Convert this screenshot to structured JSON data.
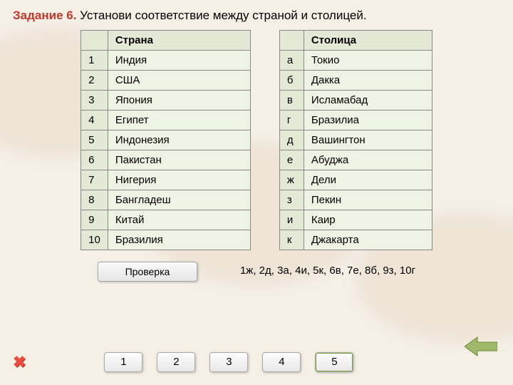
{
  "title": {
    "prefix": "Задание 6.",
    "rest": " Установи соответствие между страной и столицей."
  },
  "left": {
    "header": "Страна",
    "rows": [
      {
        "n": "1",
        "v": "Индия"
      },
      {
        "n": "2",
        "v": "США"
      },
      {
        "n": "3",
        "v": "Япония"
      },
      {
        "n": "4",
        "v": "Египет"
      },
      {
        "n": "5",
        "v": "Индонезия"
      },
      {
        "n": "6",
        "v": "Пакистан"
      },
      {
        "n": "7",
        "v": "Нигерия"
      },
      {
        "n": "8",
        "v": "Бангладеш"
      },
      {
        "n": "9",
        "v": "Китай"
      },
      {
        "n": "10",
        "v": "Бразилия"
      }
    ]
  },
  "right": {
    "header": "Столица",
    "rows": [
      {
        "n": "а",
        "v": "Токио"
      },
      {
        "n": "б",
        "v": "Дакка"
      },
      {
        "n": "в",
        "v": "Исламабад"
      },
      {
        "n": "г",
        "v": "Бразилиа"
      },
      {
        "n": "д",
        "v": "Вашингтон"
      },
      {
        "n": "е",
        "v": "Абуджа"
      },
      {
        "n": "ж",
        "v": "Дели"
      },
      {
        "n": "з",
        "v": "Пекин"
      },
      {
        "n": "и",
        "v": "Каир"
      },
      {
        "n": "к",
        "v": "Джакарта"
      }
    ]
  },
  "check_label": "Проверка",
  "answer_key": "1ж, 2д, 3а, 4и, 5к, 6в, 7е, 8б, 9з, 10г",
  "nav": [
    "1",
    "2",
    "3",
    "4",
    "5"
  ]
}
